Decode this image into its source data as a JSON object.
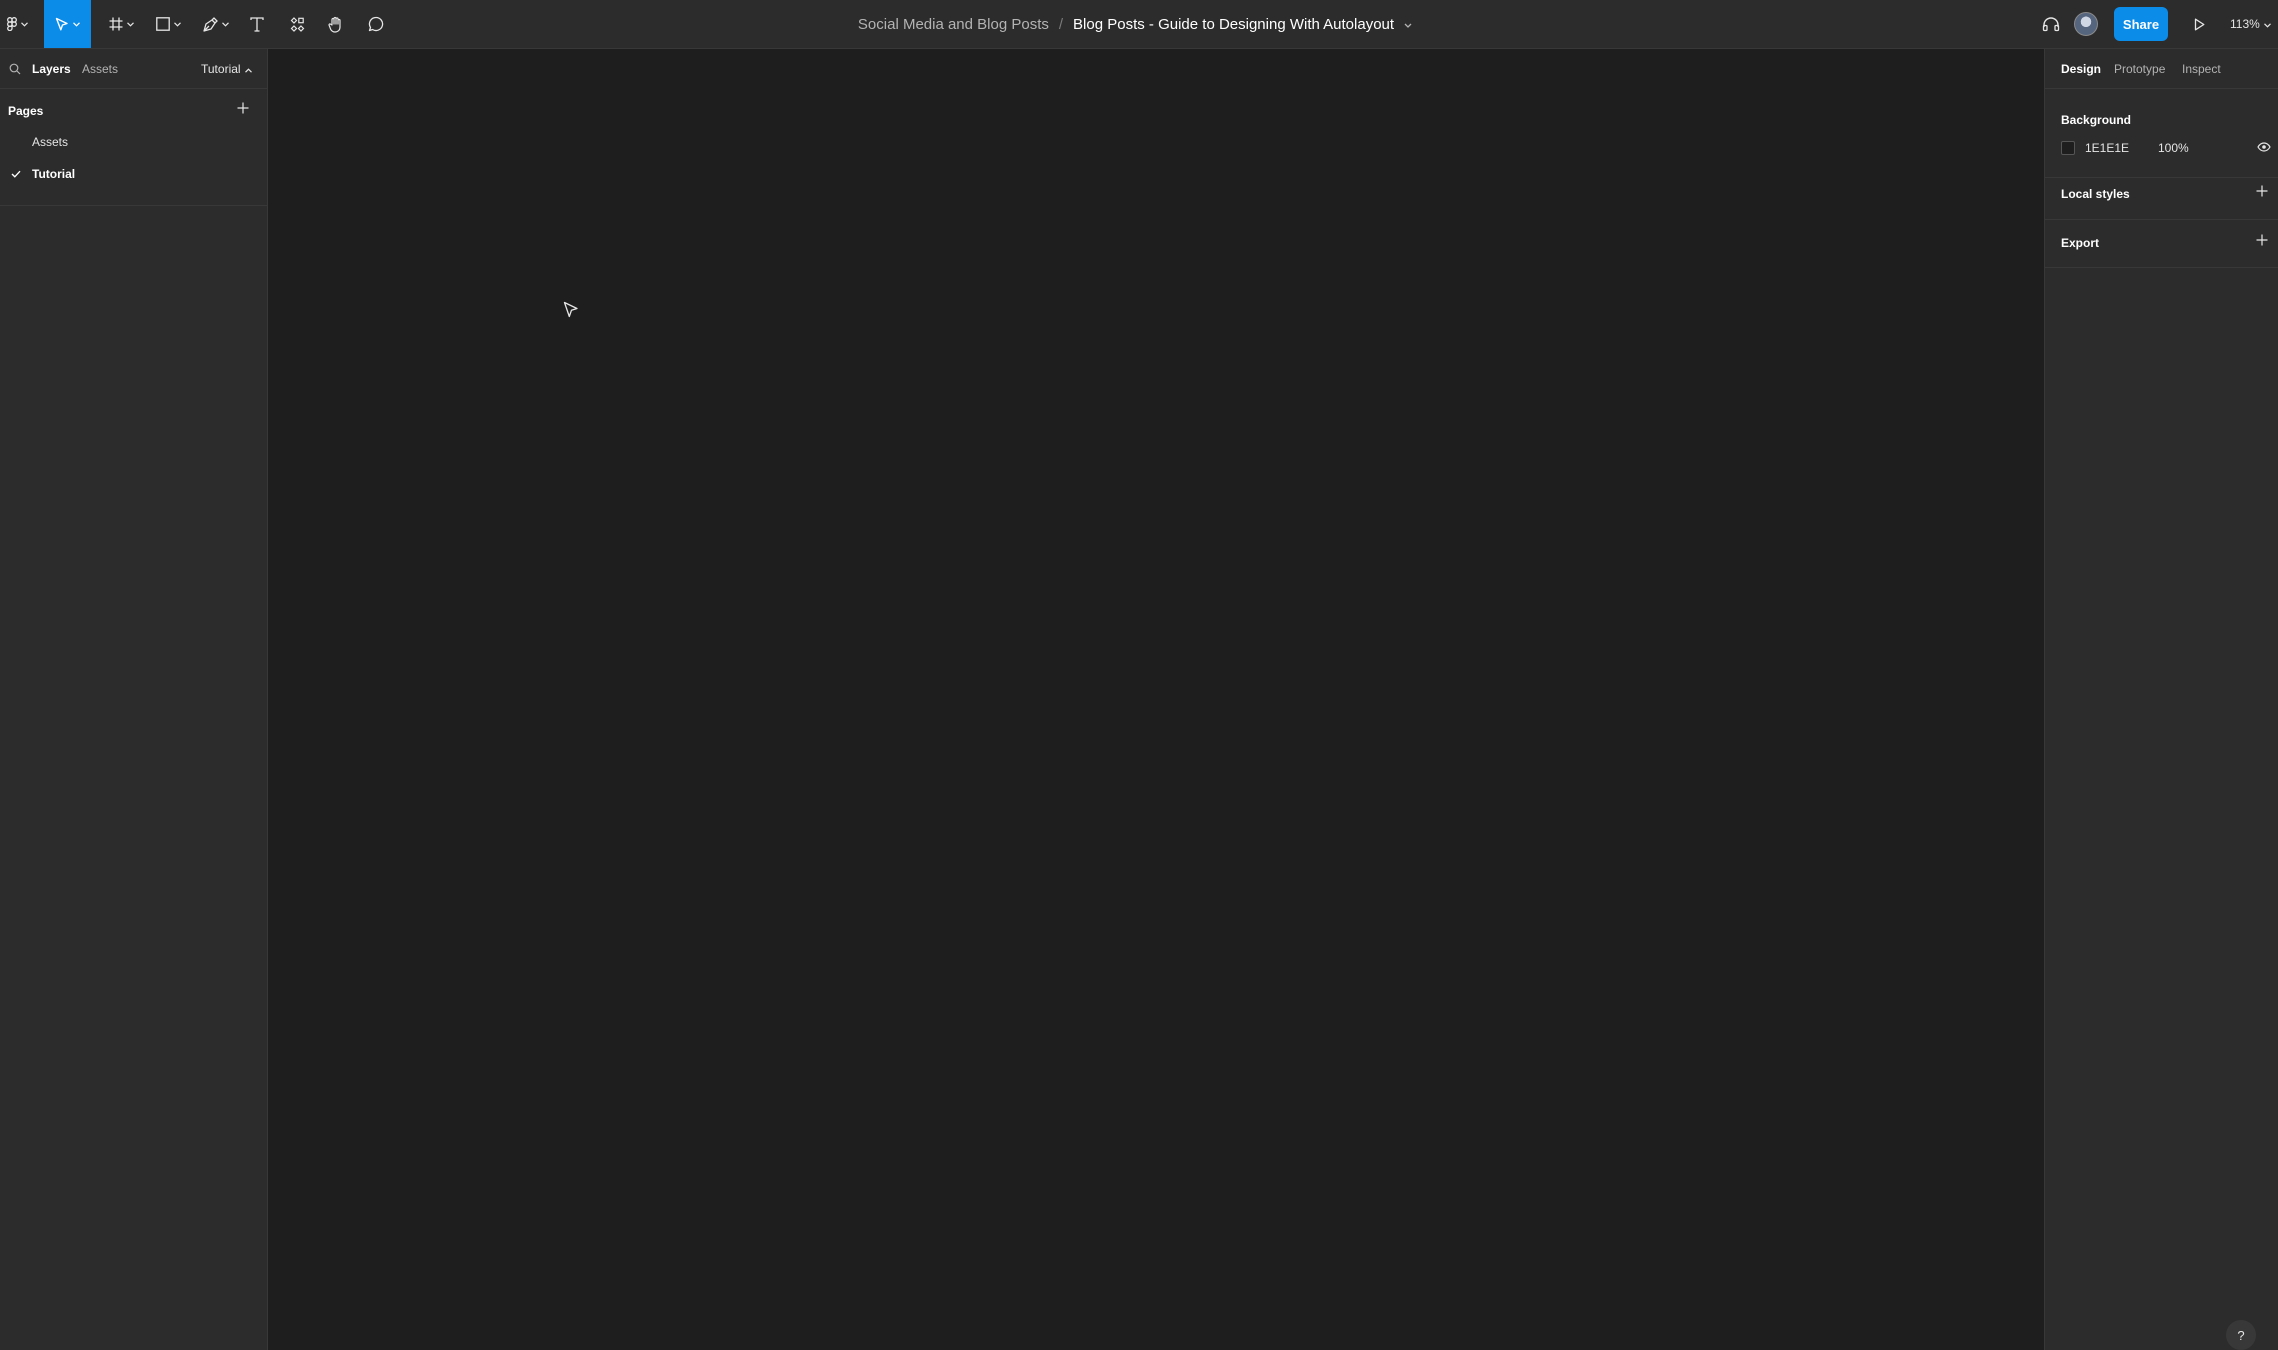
{
  "toolbar": {
    "file_project": "Social Media and Blog Posts",
    "separator": "/",
    "file_name": "Blog Posts - Guide to Designing With Autolayout",
    "share_label": "Share",
    "zoom_level": "113%",
    "tools": [
      {
        "name": "main-menu-icon"
      },
      {
        "name": "move-icon",
        "active": true
      },
      {
        "name": "frame-icon"
      },
      {
        "name": "rectangle-icon"
      },
      {
        "name": "pen-icon"
      },
      {
        "name": "text-icon"
      },
      {
        "name": "resources-icon"
      },
      {
        "name": "hand-icon"
      },
      {
        "name": "comment-icon"
      }
    ],
    "accent_color": "#0c8ce9"
  },
  "left_panel": {
    "tabs": [
      {
        "label": "Layers",
        "active": true
      },
      {
        "label": "Assets",
        "active": false
      }
    ],
    "current_page_switch": "Tutorial",
    "pages_title": "Pages",
    "pages": [
      {
        "label": "Assets",
        "current": false
      },
      {
        "label": "Tutorial",
        "current": true
      }
    ]
  },
  "right_panel": {
    "tabs": [
      {
        "label": "Design",
        "active": true
      },
      {
        "label": "Prototype",
        "active": false
      },
      {
        "label": "Inspect",
        "active": false
      }
    ],
    "background": {
      "title": "Background",
      "hex": "1E1E1E",
      "opacity": "100%",
      "swatch_color": "#1e1e1e"
    },
    "local_styles_title": "Local styles",
    "export_title": "Export"
  },
  "help_label": "?"
}
